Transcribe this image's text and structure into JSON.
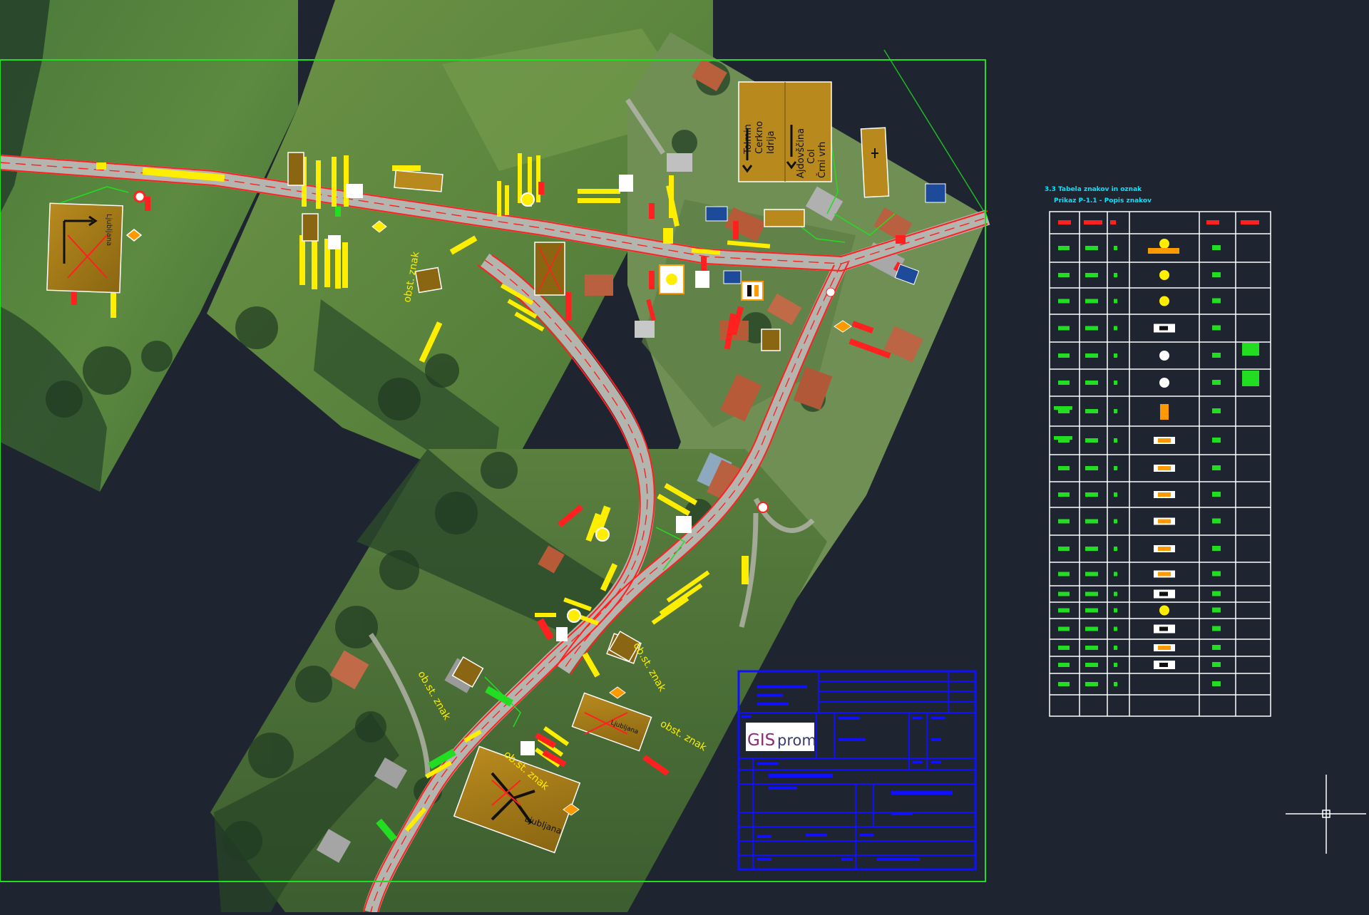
{
  "colors": {
    "background": "#1e2430",
    "frame": "#22dd22",
    "road": "#ff2020",
    "annotation": "#ffee00",
    "table_lines": "#ffffff",
    "title_block": "#1010ff",
    "legend_title": "#00e5ff"
  },
  "map": {
    "labels": {
      "obst_znak_1": "obst. znak",
      "obst_znak_2": "ob.st. znak",
      "obst_znak_3": "ob.st. znak",
      "obst_znak_4": "obst. znak",
      "obst_znak_5": "ob.st. znak"
    },
    "signs": {
      "direction_sign_top": {
        "left_col": [
          "Tolmin",
          "Cerkno",
          "Idrija"
        ],
        "right_col": [
          "Ajdovščina",
          "Col",
          "Črni vrh"
        ]
      },
      "direction_sign_bottom": "Ljubljana",
      "direction_sign_small": "Ljubljana"
    }
  },
  "legend": {
    "title_line1": "3.3 Tabela znakov in oznak",
    "title_line2": "Prikaz P-1.1 - Popis znakov"
  },
  "title_block": {
    "logo_text_gis": "GIS",
    "logo_text_prom": "prom"
  },
  "cursor": {
    "icon": "crosshair-cursor-icon"
  }
}
